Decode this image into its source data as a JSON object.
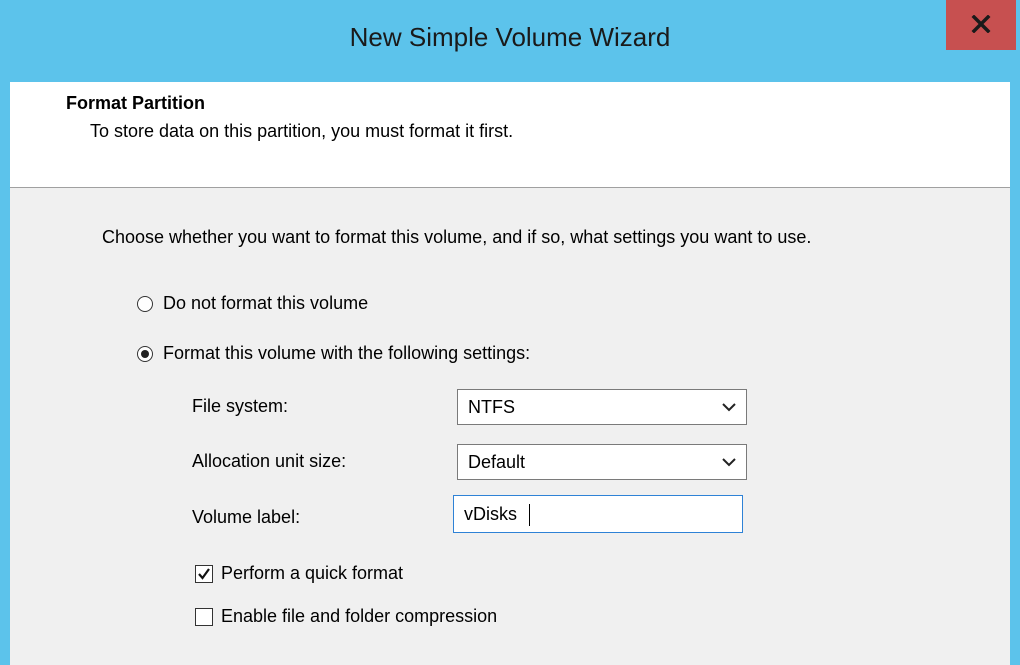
{
  "window": {
    "title": "New Simple Volume Wizard",
    "close_glyph": "x"
  },
  "header": {
    "title": "Format Partition",
    "subtitle": "To store data on this partition, you must format it first."
  },
  "content": {
    "instructions": "Choose whether you want to format this volume, and if so, what settings you want to use.",
    "options": [
      {
        "label": "Do not format this volume",
        "checked": false
      },
      {
        "label": "Format this volume with the following settings:",
        "checked": true
      }
    ],
    "file_system": {
      "label": "File system:",
      "value": "NTFS"
    },
    "allocation_unit_size": {
      "label": "Allocation unit size:",
      "value": "Default"
    },
    "volume_label": {
      "label": "Volume label:",
      "value": "vDisks"
    },
    "quick_format": {
      "label": "Perform a quick format",
      "checked": true
    },
    "compression": {
      "label": "Enable file and folder compression",
      "checked": false
    }
  },
  "colors": {
    "title_bar": "#5cc3eb",
    "close_button": "#c75050",
    "focus_border": "#2e82d6"
  }
}
